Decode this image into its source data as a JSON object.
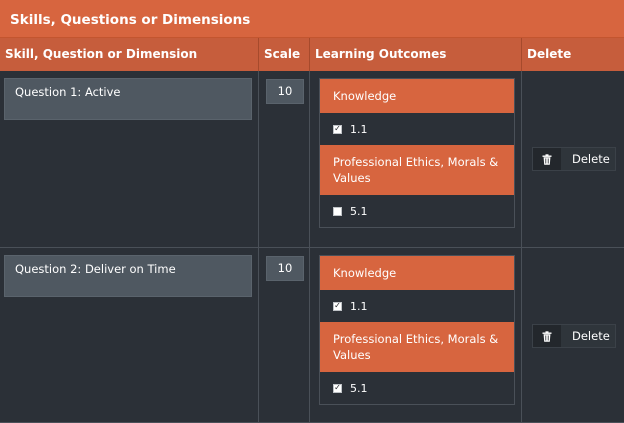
{
  "panel": {
    "title": "Skills, Questions or Dimensions"
  },
  "columns": {
    "skill": "Skill, Question or Dimension",
    "scale": "Scale",
    "learning_outcomes": "Learning Outcomes",
    "delete": "Delete"
  },
  "rows": [
    {
      "question": "Question 1: Active",
      "scale": "10",
      "outcome_groups": [
        {
          "name": "Knowledge",
          "items": [
            {
              "label": "1.1",
              "checked": true
            }
          ]
        },
        {
          "name": "Professional Ethics, Morals & Values",
          "items": [
            {
              "label": "5.1",
              "checked": false
            }
          ]
        }
      ],
      "delete_label": "Delete"
    },
    {
      "question": "Question 2: Deliver on Time",
      "scale": "10",
      "outcome_groups": [
        {
          "name": "Knowledge",
          "items": [
            {
              "label": "1.1",
              "checked": true
            }
          ]
        },
        {
          "name": "Professional Ethics, Morals & Values",
          "items": [
            {
              "label": "5.1",
              "checked": true
            }
          ]
        }
      ],
      "delete_label": "Delete"
    }
  ],
  "colors": {
    "accent": "#d7653f",
    "header": "#c65d3c",
    "background": "#2b3037",
    "input": "#4f5861"
  },
  "icons": {
    "delete": "trash-icon",
    "checkbox": "checkbox-icon"
  }
}
